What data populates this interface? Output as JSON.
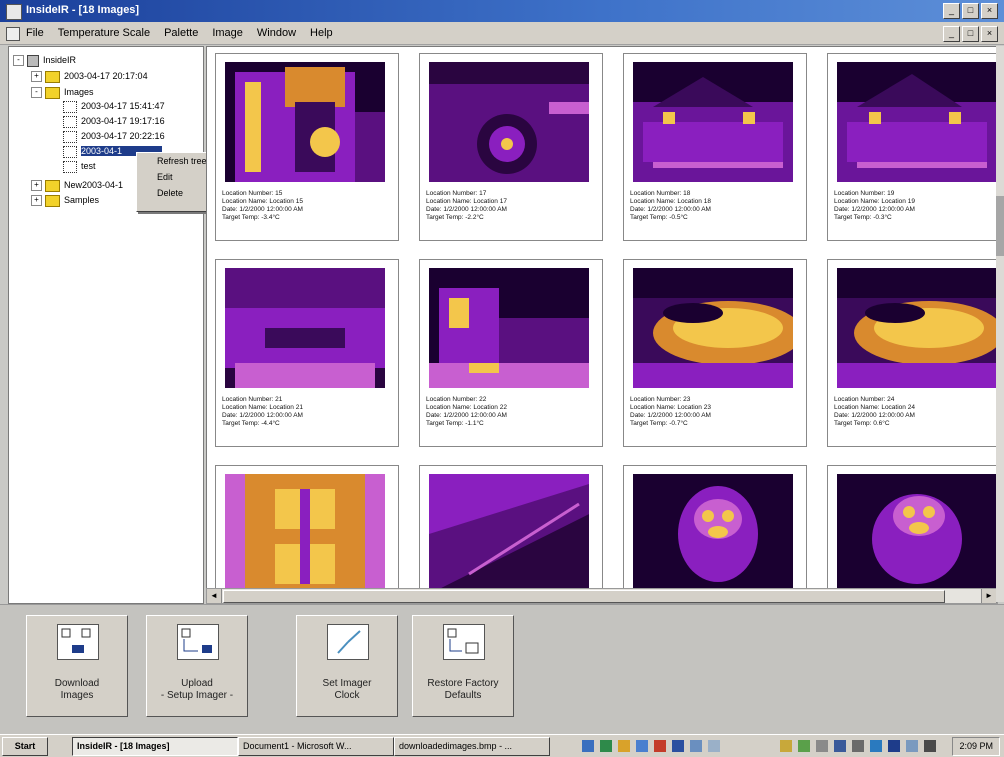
{
  "window": {
    "title": "InsideIR - [18 Images]"
  },
  "menu": [
    "File",
    "Temperature Scale",
    "Palette",
    "Image",
    "Window",
    "Help"
  ],
  "tree": {
    "root": "InsideIR",
    "folder1": "2003-04-17 20:17:04",
    "images_folder": "Images",
    "sub_items": [
      "2003-04-17 15:41:47",
      "2003-04-17 19:17:16",
      "2003-04-17 20:22:16",
      "2003-04-1",
      "test"
    ],
    "folder2": "New2003-04-1",
    "folder3": "Samples"
  },
  "context_menu": [
    "Refresh tree view",
    "Edit",
    "Delete"
  ],
  "cards": [
    {
      "lines": [
        "Location Number: 15",
        "Location Name: Location 15",
        "Date: 1/2/2000 12:00:00 AM",
        "Target Temp: -3.4°C"
      ]
    },
    {
      "lines": [
        "Location Number: 17",
        "Location Name: Location 17",
        "Date: 1/2/2000 12:00:00 AM",
        "Target Temp: -2.2°C"
      ]
    },
    {
      "lines": [
        "Location Number: 18",
        "Location Name: Location 18",
        "Date: 1/2/2000 12:00:00 AM",
        "Target Temp: -0.5°C"
      ]
    },
    {
      "lines": [
        "Location Number: 19",
        "Location Name: Location 19",
        "Date: 1/2/2000 12:00:00 AM",
        "Target Temp: -0.3°C"
      ]
    },
    {
      "lines": [
        "Location Number: 21",
        "Location Name: Location 21",
        "Date: 1/2/2000 12:00:00 AM",
        "Target Temp: -4.4°C"
      ]
    },
    {
      "lines": [
        "Location Number: 22",
        "Location Name: Location 22",
        "Date: 1/2/2000 12:00:00 AM",
        "Target Temp: -1.1°C"
      ]
    },
    {
      "lines": [
        "Location Number: 23",
        "Location Name: Location 23",
        "Date: 1/2/2000 12:00:00 AM",
        "Target Temp: -0.7°C"
      ]
    },
    {
      "lines": [
        "Location Number: 24",
        "Location Name: Location 24",
        "Date: 1/2/2000 12:00:00 AM",
        "Target Temp: 0.6°C"
      ]
    },
    {
      "lines": []
    },
    {
      "lines": []
    },
    {
      "lines": []
    },
    {
      "lines": []
    }
  ],
  "toolbar": {
    "download": [
      "Download",
      "Images"
    ],
    "upload": [
      "Upload",
      "- Setup Imager -"
    ],
    "set_clock": [
      "Set Imager",
      "Clock"
    ],
    "restore": [
      "Restore Factory",
      "Defaults"
    ]
  },
  "taskbar": {
    "start": "Start",
    "tasks": [
      "InsideIR - [18 Images]",
      "Document1 - Microsoft W...",
      "downloadedimages.bmp - ..."
    ],
    "clock": "2:09 PM"
  },
  "colors": {
    "thermal_dark": "#1a0030",
    "thermal_mid": "#8a1fbf",
    "thermal_hot": "#f3c64b",
    "selection": "#1e3c8a"
  }
}
